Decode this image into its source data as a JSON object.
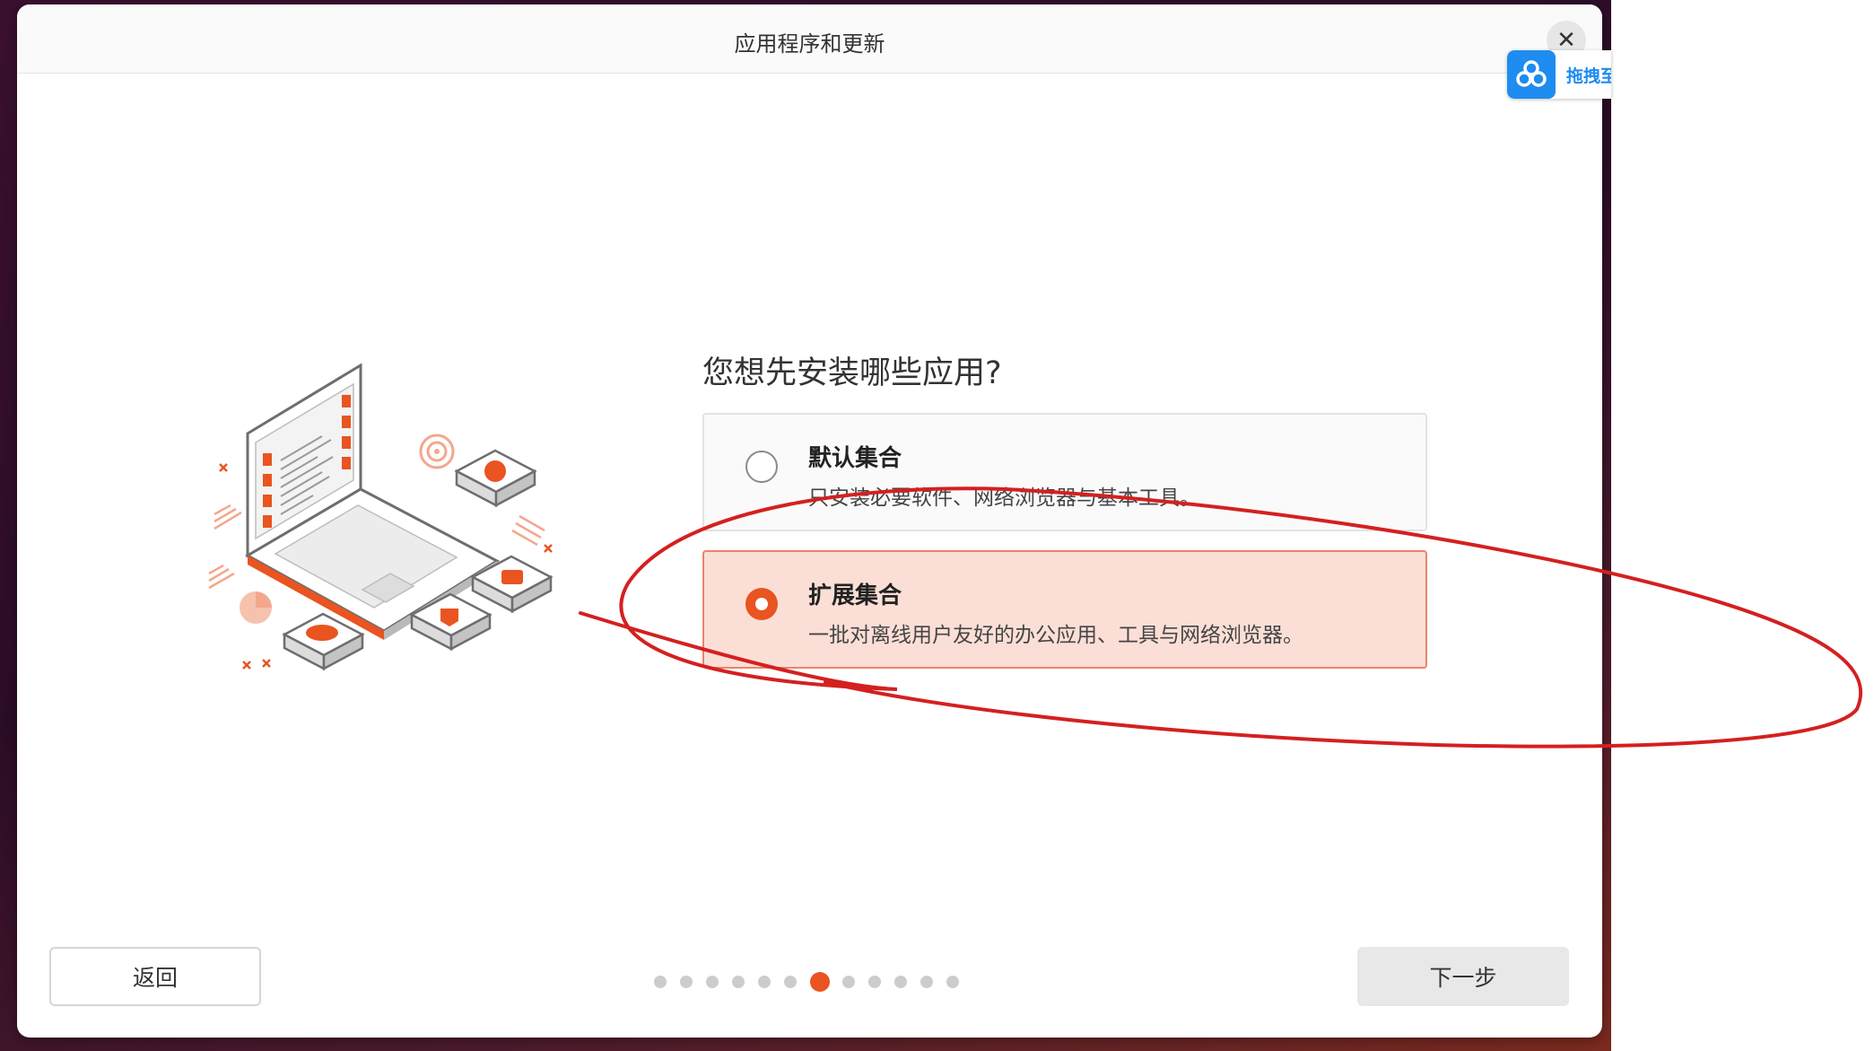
{
  "window": {
    "title": "应用程序和更新",
    "close_symbol": "✕"
  },
  "main": {
    "question": "您想先安装哪些应用?",
    "options": [
      {
        "title": "默认集合",
        "description": "只安装必要软件、网络浏览器与基本工具。",
        "selected": false
      },
      {
        "title": "扩展集合",
        "description": "一批对离线用户友好的办公应用、工具与网络浏览器。",
        "selected": true
      }
    ]
  },
  "footer": {
    "back_label": "返回",
    "next_label": "下一步",
    "steps_total": 12,
    "steps_current": 7
  },
  "overlay": {
    "cloud_label": "拖拽至",
    "cloud_icon": "baidu-netdisk-icon"
  },
  "colors": {
    "accent": "#e95420",
    "selected_bg": "#fbdfd6",
    "annotation": "#d42020"
  },
  "icons": [
    "close-icon",
    "radio-unchecked-icon",
    "radio-checked-icon",
    "laptop-illustration",
    "cloud-drive-icon"
  ]
}
